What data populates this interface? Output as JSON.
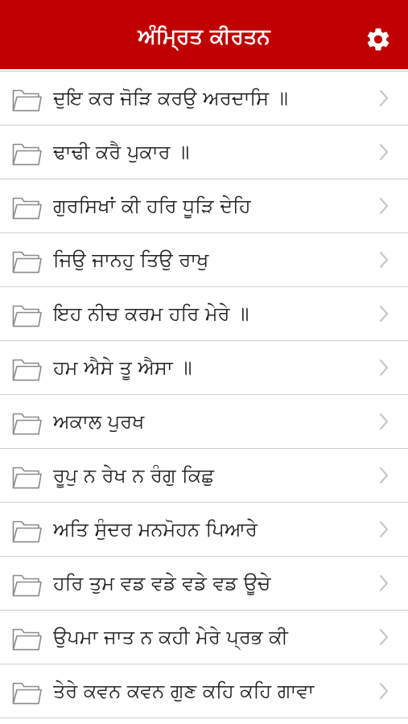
{
  "header": {
    "title": "ਅੰਮ੍ਰਿਤ ਕੀਰਤਨ",
    "background": "#c00000",
    "settings_icon": "gear-icon"
  },
  "list": {
    "folder_icon": "folder-icon",
    "chevron_icon": "chevron-right-icon",
    "items": [
      {
        "label": "ਦੁਇ ਕਰ ਜੋੜਿ ਕਰਉ ਅਰਦਾਸਿ ॥"
      },
      {
        "label": "ਢਾਢੀ ਕਰੈ ਪੁਕਾਰ ॥"
      },
      {
        "label": "ਗੁਰਸਿਖਾਂ ਕੀ ਹਰਿ ਧੂੜਿ ਦੇਹਿ"
      },
      {
        "label": "ਜਿਉ ਜਾਨਹੁ ਤਿਉ ਰਾਖੁ"
      },
      {
        "label": "ਇਹ ਨੀਚ ਕਰਮ ਹਰਿ ਮੇਰੇ ॥"
      },
      {
        "label": "ਹਮ ਐਸੇ ਤੂ ਐਸਾ ॥"
      },
      {
        "label": "ਅਕਾਲ ਪੁਰਖ"
      },
      {
        "label": "ਰੂਪੁ ਨ ਰੇਖ ਨ ਰੰਗੁ ਕਿਛੁ"
      },
      {
        "label": "ਅਤਿ ਸੁੰਦਰ ਮਨਮੋਹਨ ਪਿਆਰੇ"
      },
      {
        "label": "ਹਰਿ ਤੁਮ ਵਡ ਵਡੇ ਵਡੇ ਵਡ ਊਚੇ"
      },
      {
        "label": "ਉਪਮਾ ਜਾਤ ਨ ਕਹੀ ਮੇਰੇ ਪ੍ਰਭ ਕੀ"
      },
      {
        "label": "ਤੇਰੇ ਕਵਨ ਕਵਨ ਗੁਣ ਕਹਿ ਕਹਿ ਗਾਵਾ"
      }
    ]
  }
}
